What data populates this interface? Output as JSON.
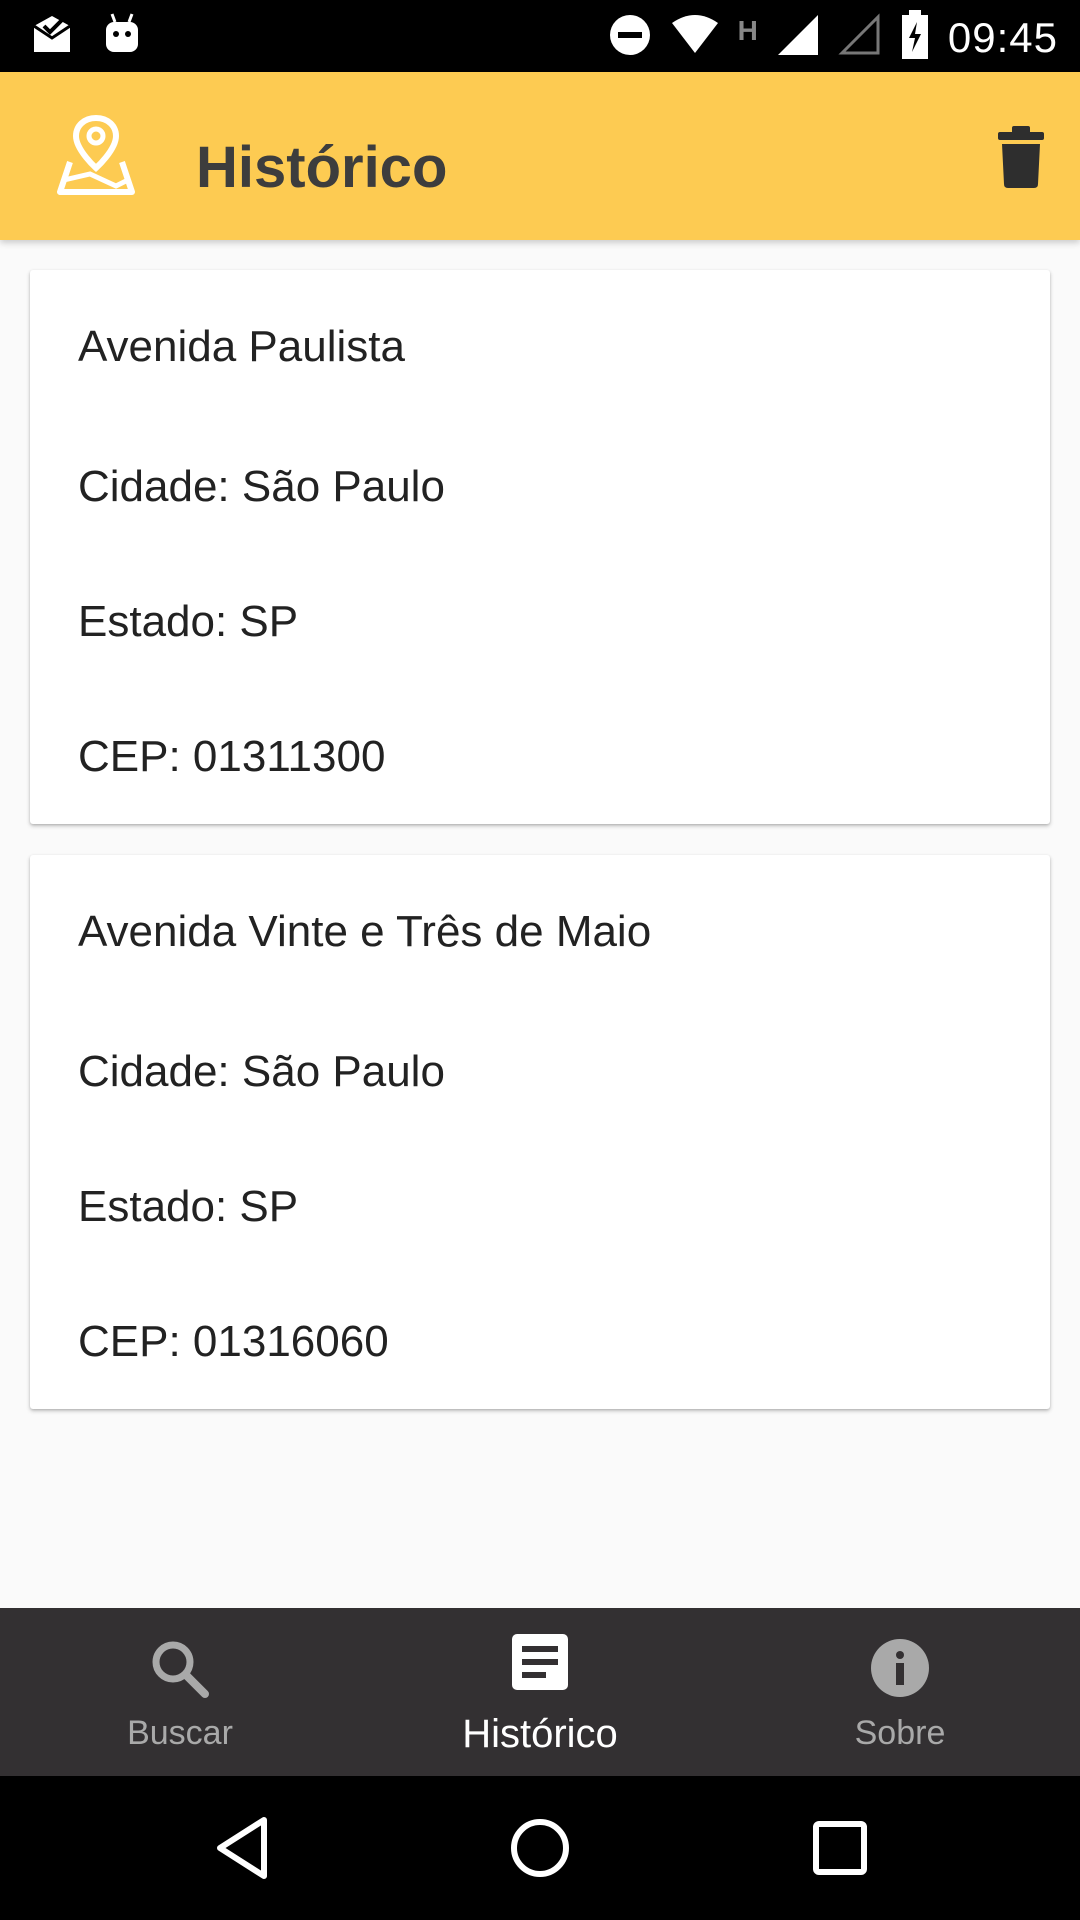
{
  "status_bar": {
    "time": "09:45",
    "network_letter": "H",
    "icons": [
      "mail-done-icon",
      "android-debug-icon",
      "do-not-disturb-icon",
      "wifi-icon",
      "signal-icon",
      "signal-empty-icon",
      "battery-charging-icon"
    ]
  },
  "app_bar": {
    "title": "Histórico",
    "logo_icon": "map-pin-icon",
    "action_icon": "trash-icon",
    "background": "#fdcb52"
  },
  "history": [
    {
      "street": "Avenida Paulista",
      "city": "Cidade: São Paulo",
      "state": "Estado: SP",
      "cep": "CEP: 01311300"
    },
    {
      "street": "Avenida Vinte e Três de Maio",
      "city": "Cidade: São Paulo",
      "state": "Estado: SP",
      "cep": "CEP: 01316060"
    }
  ],
  "bottom_nav": {
    "items": [
      {
        "label": "Buscar",
        "icon": "search-icon",
        "active": false
      },
      {
        "label": "Histórico",
        "icon": "article-icon",
        "active": true
      },
      {
        "label": "Sobre",
        "icon": "info-icon",
        "active": false
      }
    ],
    "background": "#333032"
  },
  "system_nav": {
    "icons": [
      "back-icon",
      "home-icon",
      "recents-icon"
    ]
  }
}
